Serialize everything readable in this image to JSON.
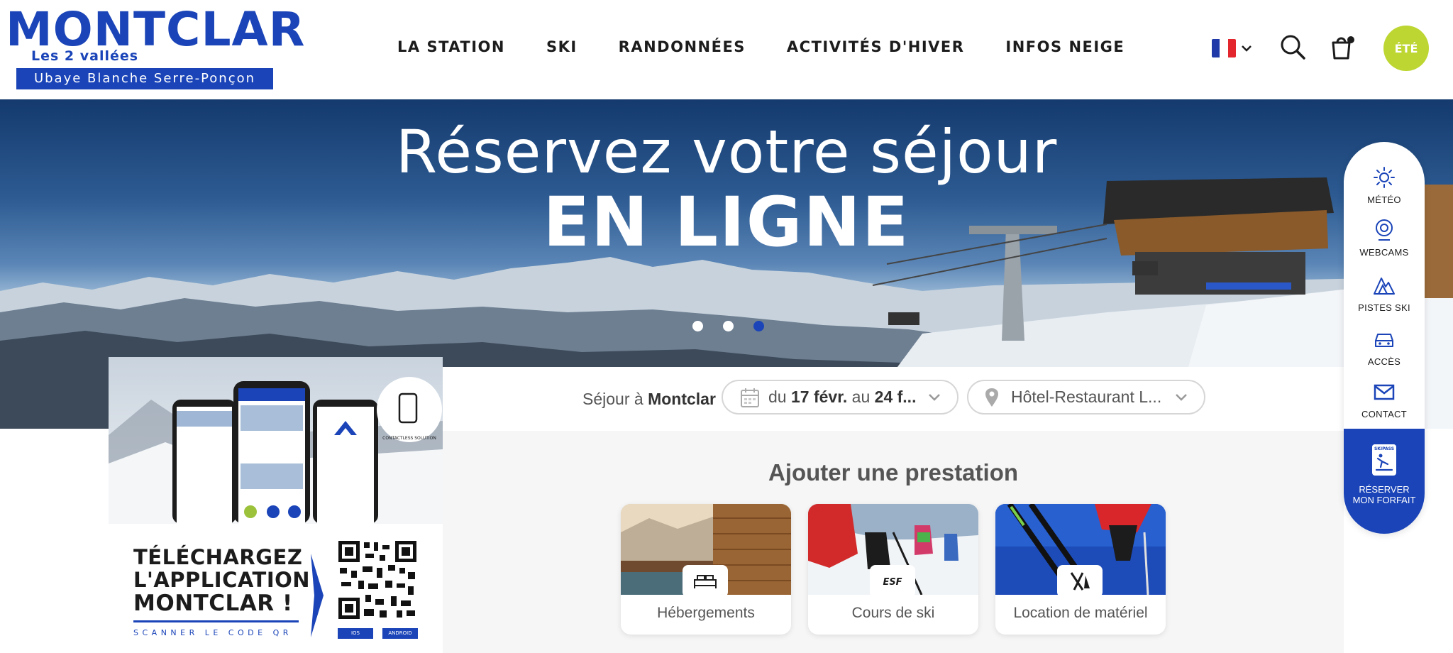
{
  "brand": {
    "name": "MONTCLAR",
    "tagline": "Les 2 vallées",
    "band": "Ubaye  Blanche Serre-Ponçon",
    "color": "#1a44b8"
  },
  "nav": {
    "items": [
      {
        "label": "LA STATION"
      },
      {
        "label": "SKI"
      },
      {
        "label": "RANDONNÉES"
      },
      {
        "label": "ACTIVITÉS D'HIVER"
      },
      {
        "label": "INFOS NEIGE"
      }
    ]
  },
  "header": {
    "language_flag": "fr-flag-icon",
    "search_icon": "search-icon",
    "cart_icon": "shopping-bag-icon",
    "season_button": "ÉTÉ",
    "season_color": "#bdd631"
  },
  "hero": {
    "title": "Réservez votre séjour",
    "subtitle": "EN LIGNE",
    "slides": 3,
    "active_slide": 3,
    "active_dot_color": "#1a44b8"
  },
  "sidebar": {
    "items": [
      {
        "label": "MÉTÉO",
        "icon": "sun-icon"
      },
      {
        "label": "WEBCAMS",
        "icon": "webcam-icon"
      },
      {
        "label": "PISTES SKI",
        "icon": "mountain-icon"
      },
      {
        "label": "ACCÈS",
        "icon": "car-icon"
      },
      {
        "label": "CONTACT",
        "icon": "mail-icon"
      }
    ],
    "cta": {
      "label": "RÉSERVER MON FORFAIT",
      "icon": "ski-pass-icon",
      "icon_text": "SKIPASS"
    }
  },
  "app_promo": {
    "line1": "TÉLÉCHARGEZ",
    "line2": "L'APPLICATION",
    "line3": "MONTCLAR !",
    "scan": "SCANNER LE CODE QR",
    "badge": "CONTACTLESS SOLUTION",
    "ios_label": "IOS",
    "android_label": "ANDROID"
  },
  "booking": {
    "stay_prefix": "Séjour à",
    "stay_place": "Montclar",
    "dates": {
      "from_prefix": "du",
      "from": "17 févr.",
      "to_prefix": "au",
      "to": "24 f..."
    },
    "hotel": "Hôtel-Restaurant L...",
    "section_title": "Ajouter une prestation",
    "cards": [
      {
        "label": "Hébergements",
        "icon": "bed-icon"
      },
      {
        "label": "Cours de ski",
        "icon": "esf-icon",
        "icon_text": "ESF"
      },
      {
        "label": "Location de matériel",
        "icon": "ski-rental-icon"
      }
    ]
  }
}
